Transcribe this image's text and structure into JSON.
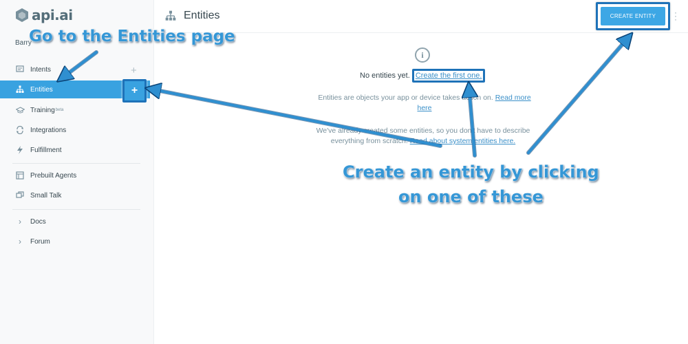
{
  "app": {
    "logo_text": "api.ai",
    "agent_name": "Barry"
  },
  "header": {
    "title": "Entities",
    "create_button": "CREATE ENTITY"
  },
  "sidebar": {
    "items": [
      {
        "label": "Intents",
        "icon": "intents-icon"
      },
      {
        "label": "Entities",
        "icon": "entities-icon",
        "active": true
      },
      {
        "label": "Training",
        "icon": "training-icon",
        "badge": "beta"
      },
      {
        "label": "Integrations",
        "icon": "integrations-icon"
      },
      {
        "label": "Fulfillment",
        "icon": "fulfillment-icon"
      },
      {
        "label": "Prebuilt Agents",
        "icon": "prebuilt-agents-icon"
      },
      {
        "label": "Small Talk",
        "icon": "small-talk-icon"
      },
      {
        "label": "Docs",
        "icon": "chevron-right-icon"
      },
      {
        "label": "Forum",
        "icon": "chevron-right-icon"
      }
    ],
    "add_symbol": "+"
  },
  "main": {
    "empty_prefix": "No entities yet.",
    "create_first_link": "Create the first one.",
    "para1_line1": "Entities are objects your app or device takes action on.",
    "para1_link_a": "Read more",
    "para1_link_b": "here",
    "para2_line1": "We've already created some entities, so you don't have to describe",
    "para2_line2": "everything from scratch.",
    "para2_link": "Read about system entities here."
  },
  "annotations": {
    "goto_entities": "Go to the Entities page",
    "create_line1": "Create an entity by clicking",
    "create_line2": "on one of these"
  },
  "colors": {
    "accent": "#39a2e0",
    "annotation_blue": "#3597d6",
    "highlight_border": "#1e72b8"
  }
}
